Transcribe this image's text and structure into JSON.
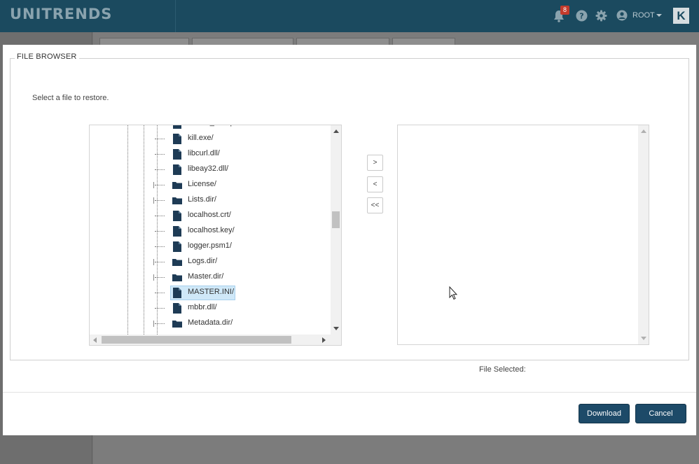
{
  "header": {
    "logo": "UNITRENDS",
    "notification_count": "8",
    "user_label": "ROOT",
    "brand_letter": "K"
  },
  "modal": {
    "legend": "FILE BROWSER",
    "instruction": "Select a file to restore.",
    "tree_items": [
      {
        "label": "invoke_cscript.exe/",
        "type": "file"
      },
      {
        "label": "kill.exe/",
        "type": "file"
      },
      {
        "label": "libcurl.dll/",
        "type": "file"
      },
      {
        "label": "libeay32.dll/",
        "type": "file"
      },
      {
        "label": "License/",
        "type": "folder"
      },
      {
        "label": "Lists.dir/",
        "type": "folder"
      },
      {
        "label": "localhost.crt/",
        "type": "file"
      },
      {
        "label": "localhost.key/",
        "type": "file"
      },
      {
        "label": "logger.psm1/",
        "type": "file"
      },
      {
        "label": "Logs.dir/",
        "type": "folder"
      },
      {
        "label": "Master.dir/",
        "type": "folder"
      },
      {
        "label": "MASTER.INI/",
        "type": "file",
        "selected": true
      },
      {
        "label": "mbbr.dll/",
        "type": "file"
      },
      {
        "label": "Metadata.dir/",
        "type": "folder"
      }
    ],
    "move_buttons": {
      "add": ">",
      "remove": "<",
      "remove_all": "<<"
    },
    "file_selected_label": "File Selected:",
    "buttons": {
      "download": "Download",
      "cancel": "Cancel"
    }
  },
  "colors": {
    "header_bg": "#1b4a5f",
    "primary_button": "#1d4a68",
    "selection": "#cfe8f8",
    "icon": "#1e3b55",
    "badge": "#c43b2c"
  }
}
